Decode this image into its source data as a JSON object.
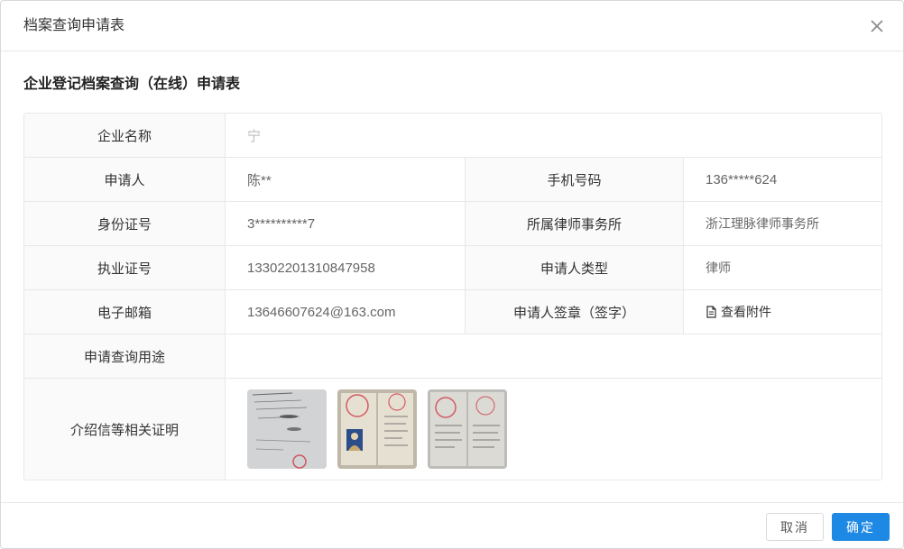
{
  "dialog": {
    "title": "档案查询申请表",
    "close_icon": "close-icon"
  },
  "form": {
    "title": "企业登记档案查询（在线）申请表",
    "company_name": {
      "label": "企业名称",
      "value": "宁"
    },
    "applicant": {
      "label": "申请人",
      "value": "陈**"
    },
    "phone": {
      "label": "手机号码",
      "value": "136*****624"
    },
    "id_number": {
      "label": "身份证号",
      "value": "3**********7"
    },
    "law_firm": {
      "label": "所属律师事务所",
      "value": "浙江理脉律师事务所"
    },
    "license_no": {
      "label": "执业证号",
      "value": "13302201310847958"
    },
    "applicant_type": {
      "label": "申请人类型",
      "value": "律师"
    },
    "email": {
      "label": "电子邮箱",
      "value": "13646607624@163.com"
    },
    "signature": {
      "label": "申请人签章（签字）",
      "link_text": "查看附件",
      "icon": "file-icon"
    },
    "purpose": {
      "label": "申请查询用途",
      "value": ""
    },
    "documents": {
      "label": "介绍信等相关证明",
      "thumbnails": [
        "document-photo-1",
        "document-photo-2",
        "document-photo-3"
      ]
    }
  },
  "footer": {
    "cancel_label": "取消",
    "ok_label": "确定"
  },
  "colors": {
    "primary": "#1e88e5",
    "label_bg": "#fafafa",
    "border": "#e8e8e8"
  }
}
